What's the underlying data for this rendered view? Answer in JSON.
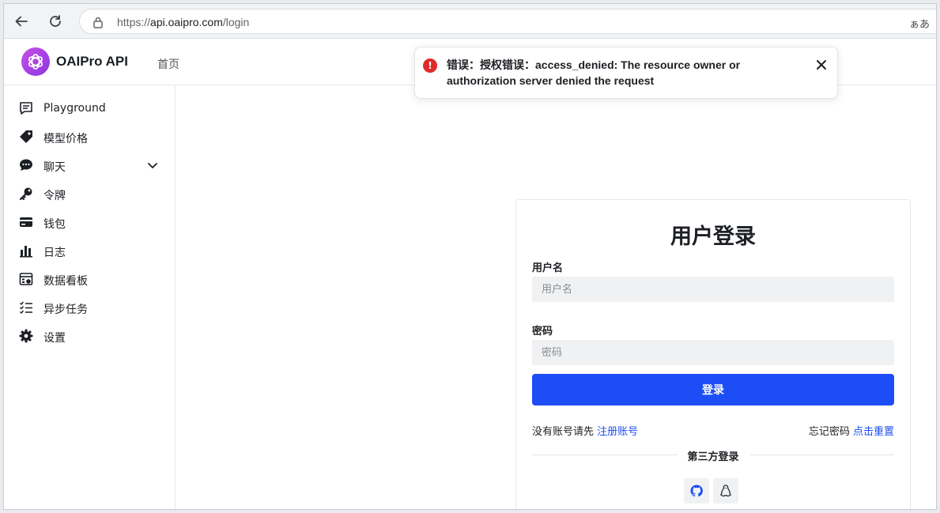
{
  "browser": {
    "url_scheme": "https://",
    "url_host": "api.oaipro.com",
    "url_path": "/login",
    "translate_label": "ぁあ"
  },
  "header": {
    "app_name": "OAIPro API",
    "nav_home": "首页"
  },
  "sidebar": {
    "items": [
      {
        "label": "Playground",
        "icon": "chat-box-icon"
      },
      {
        "label": "模型价格",
        "icon": "price-tag-icon"
      },
      {
        "label": "聊天",
        "icon": "chat-bubble-icon"
      },
      {
        "label": "令牌",
        "icon": "key-icon"
      },
      {
        "label": "钱包",
        "icon": "credit-card-icon"
      },
      {
        "label": "日志",
        "icon": "bar-chart-icon"
      },
      {
        "label": "数据看板",
        "icon": "dashboard-icon"
      },
      {
        "label": "异步任务",
        "icon": "checklist-icon"
      },
      {
        "label": "设置",
        "icon": "gear-icon"
      }
    ]
  },
  "toast": {
    "message": "错误：授权错误：access_denied: The resource owner or authorization server denied the request"
  },
  "login": {
    "title": "用户登录",
    "username_label": "用户名",
    "username_placeholder": "用户名",
    "password_label": "密码",
    "password_placeholder": "密码",
    "submit_label": "登录",
    "no_account_text": "没有账号请先",
    "register_link": "注册账号",
    "forgot_text": "忘记密码",
    "reset_link": "点击重置",
    "third_party_title": "第三方登录"
  },
  "colors": {
    "primary": "#1d4ef5",
    "error": "#e02b2b",
    "logo": "#a742e6"
  }
}
